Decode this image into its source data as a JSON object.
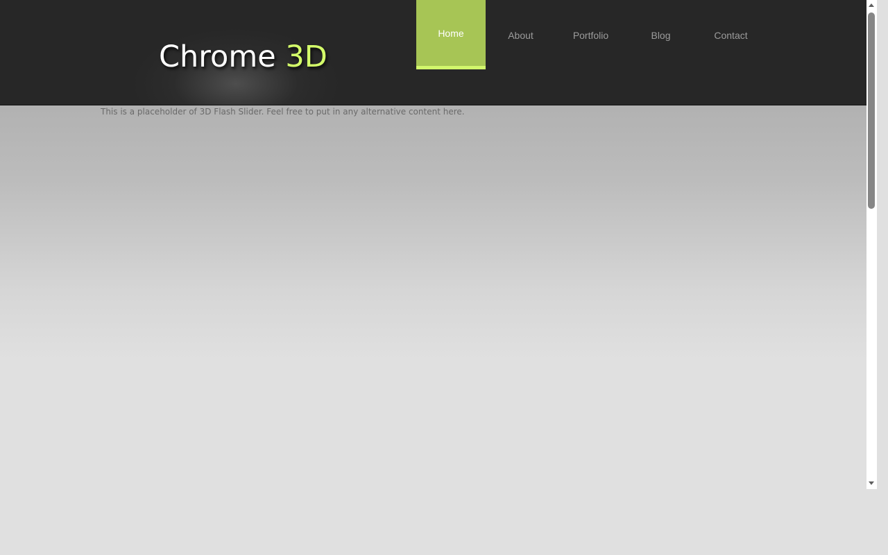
{
  "logo": {
    "word": "Chrome",
    "accent": "3D"
  },
  "nav": {
    "items": [
      {
        "label": "Home",
        "active": true
      },
      {
        "label": "About",
        "active": false
      },
      {
        "label": "Portfolio",
        "active": false
      },
      {
        "label": "Blog",
        "active": false
      },
      {
        "label": "Contact",
        "active": false
      }
    ]
  },
  "content": {
    "placeholder": "This is a placeholder of 3D Flash Slider. Feel free to put in any alternative content here."
  },
  "colors": {
    "header_bg": "#272727",
    "accent_green": "#a7c555",
    "accent_light_green": "#d4ff6a",
    "nav_text": "#9c9c9c"
  },
  "scrollbar": {
    "scroll_fraction": 0.0
  }
}
